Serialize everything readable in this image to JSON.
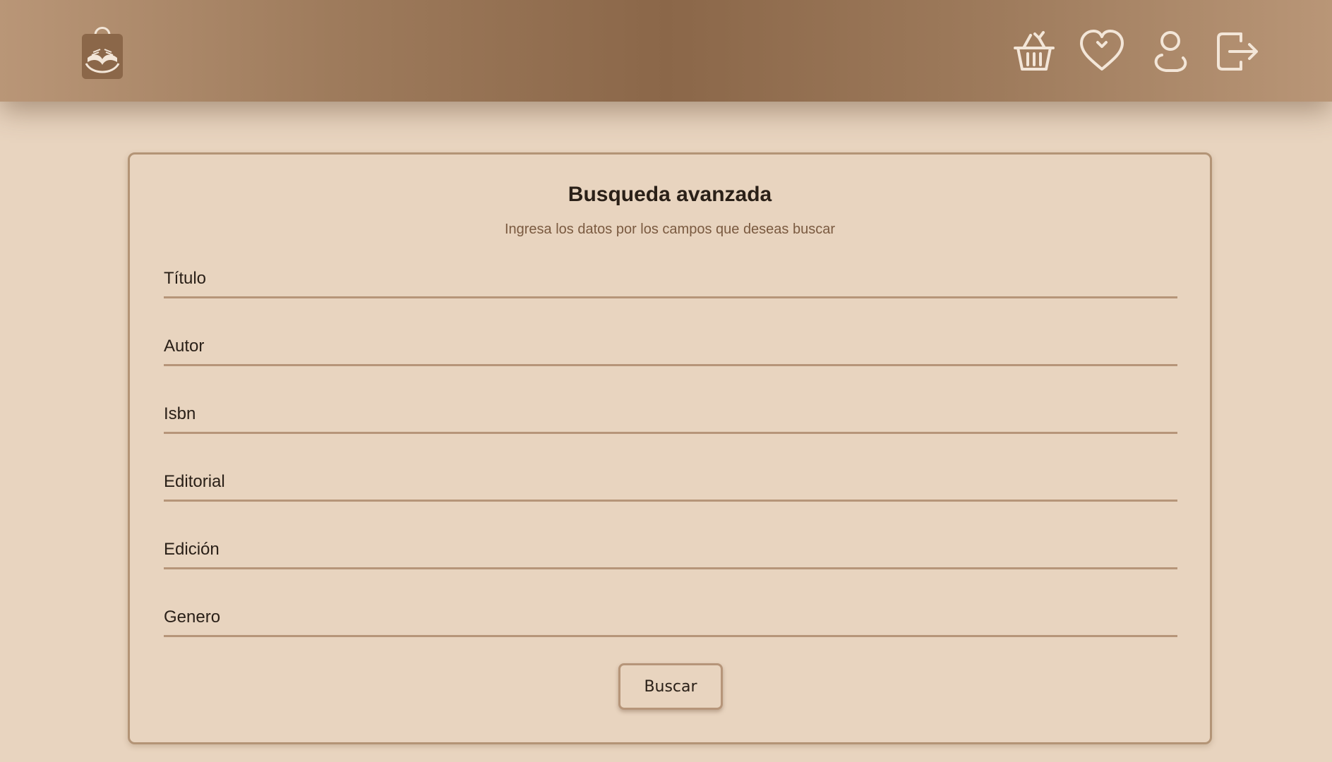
{
  "header": {
    "logo_icon": "shopping-bag-book-icon",
    "nav_icons": [
      "basket-icon",
      "heart-icon",
      "user-icon",
      "logout-icon"
    ]
  },
  "search": {
    "title": "Busqueda avanzada",
    "subtitle": "Ingresa los datos por los campos que deseas buscar",
    "fields": {
      "titulo": {
        "placeholder": "Título",
        "value": ""
      },
      "autor": {
        "placeholder": "Autor",
        "value": ""
      },
      "isbn": {
        "placeholder": "Isbn",
        "value": ""
      },
      "editorial": {
        "placeholder": "Editorial",
        "value": ""
      },
      "edicion": {
        "placeholder": "Edición",
        "value": ""
      },
      "genero": {
        "placeholder": "Genero",
        "value": ""
      }
    },
    "submit_label": "Buscar"
  },
  "colors": {
    "header_dark": "#8b6749",
    "header_light": "#b99677",
    "background": "#e8d4bf",
    "border": "#b69579",
    "text": "#2a2018",
    "subtitle": "#7a5a40"
  }
}
